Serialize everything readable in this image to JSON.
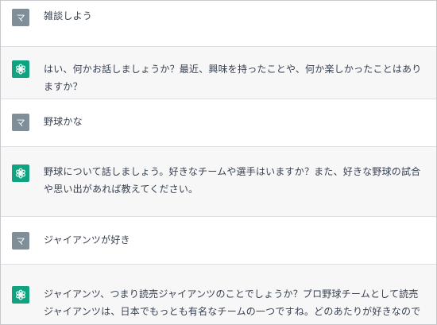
{
  "messages": [
    {
      "role": "user",
      "avatar_label": "マ",
      "text": "雑談しよう"
    },
    {
      "role": "assistant",
      "avatar_icon": "chatgpt-logo-icon",
      "text": "はい、何かお話しましょうか？最近、興味を持ったことや、何か楽しかったことはありますか？"
    },
    {
      "role": "user",
      "avatar_label": "マ",
      "text": "野球かな"
    },
    {
      "role": "assistant",
      "avatar_icon": "chatgpt-logo-icon",
      "text": "野球について話しましょう。好きなチームや選手はいますか？また、好きな野球の試合や思い出があれば教えてください。"
    },
    {
      "role": "user",
      "avatar_label": "マ",
      "text": "ジャイアンツが好き"
    },
    {
      "role": "assistant",
      "avatar_icon": "chatgpt-logo-icon",
      "text": "ジャイアンツ、つまり読売ジャイアンツのことでしょうか？プロ野球チームとして読売ジャイアンツは、日本でもっとも有名なチームの一つですね。どのあたりが好きなのでしょうか？"
    }
  ],
  "colors": {
    "assistant_avatar_bg": "#10a37f",
    "user_avatar_bg": "#7f8e97",
    "assistant_row_bg": "#f7f7f8",
    "user_row_bg": "#ffffff"
  }
}
